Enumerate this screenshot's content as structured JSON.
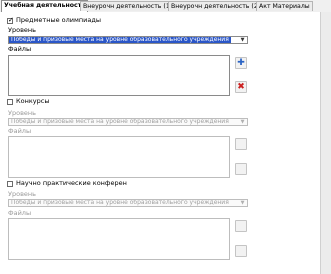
{
  "tabs": [
    {
      "label": "Учебная деятельность",
      "active": true
    },
    {
      "label": "Внеурочн деятельность (1)",
      "active": false
    },
    {
      "label": "Внеурочн деятельность (2)",
      "active": false
    },
    {
      "label": "Акт Материалы",
      "active": false
    }
  ],
  "sections": [
    {
      "checkbox_label": "Предметные олимпиады",
      "checked": true,
      "level_label": "Уровень",
      "level_value": "Победы и призовые места на уровне образовательного учреждения",
      "files_label": "Файлы",
      "enabled": true
    },
    {
      "checkbox_label": "Конкурсы",
      "checked": false,
      "level_label": "Уровень",
      "level_value": "Победы и призовые места на уровне образовательного учреждения",
      "files_label": "Файлы",
      "enabled": false
    },
    {
      "checkbox_label": "Научно практические конферен",
      "checked": false,
      "level_label": "Уровень",
      "level_value": "Победы и призовые места на уровне образовательного учреждения",
      "files_label": "Файлы",
      "enabled": false
    }
  ],
  "icons": {
    "dropdown": "chevron-down-icon",
    "add": "plus-icon",
    "delete": "x-icon"
  },
  "colors": {
    "selection": "#2a56c8",
    "add": "#2a63c4",
    "delete": "#cc2020"
  }
}
